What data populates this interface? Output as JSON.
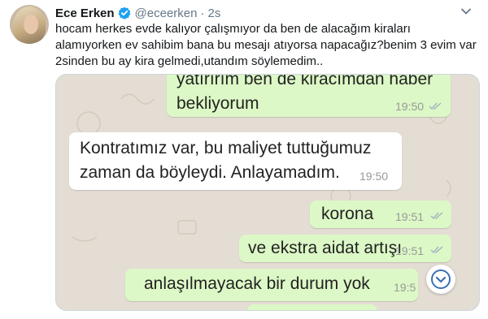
{
  "tweet": {
    "name": "Ece Erken",
    "handle": "@eceerken",
    "separator": "·",
    "time": "2s",
    "text_lines": [
      "hocam herkes evde kalıyor çalışmıyor da ben de alacağım kiraları",
      "alamıyorken ev sahibim bana bu mesajı atıyorsa napacağız?benim 3 evim var",
      "2sinden bu ay kira gelmedi,utandım söylemedim.."
    ]
  },
  "chat": {
    "messages": [
      {
        "direction": "outgoing",
        "lines": [
          "yatırırım ben de kiracımdan haber",
          "bekliyorum"
        ],
        "time": "19:50",
        "read": true
      },
      {
        "direction": "incoming",
        "lines": [
          "Kontratımız var, bu maliyet tuttuğumuz",
          "zaman da böyleydi. Anlayamadım."
        ],
        "time": "19:50"
      },
      {
        "direction": "outgoing",
        "lines": [
          "korona"
        ],
        "time": "19:51",
        "read": true
      },
      {
        "direction": "outgoing",
        "lines": [
          "ve ekstra aidat artışı"
        ],
        "time": "19:51",
        "read": true
      },
      {
        "direction": "outgoing",
        "lines": [
          "anlaşılmayacak bir durum yok"
        ],
        "time": "19:5",
        "read": true
      }
    ]
  },
  "colors": {
    "outgoing_bubble": "#dcf8c6",
    "incoming_bubble": "#ffffff",
    "chat_background": "#e4ddd4",
    "verified": "#1da1f2",
    "read_ticks": "#4fc3f7"
  },
  "icons": [
    "verified-badge-icon",
    "caret-down-icon",
    "double-check-icon",
    "chevron-down-icon"
  ]
}
